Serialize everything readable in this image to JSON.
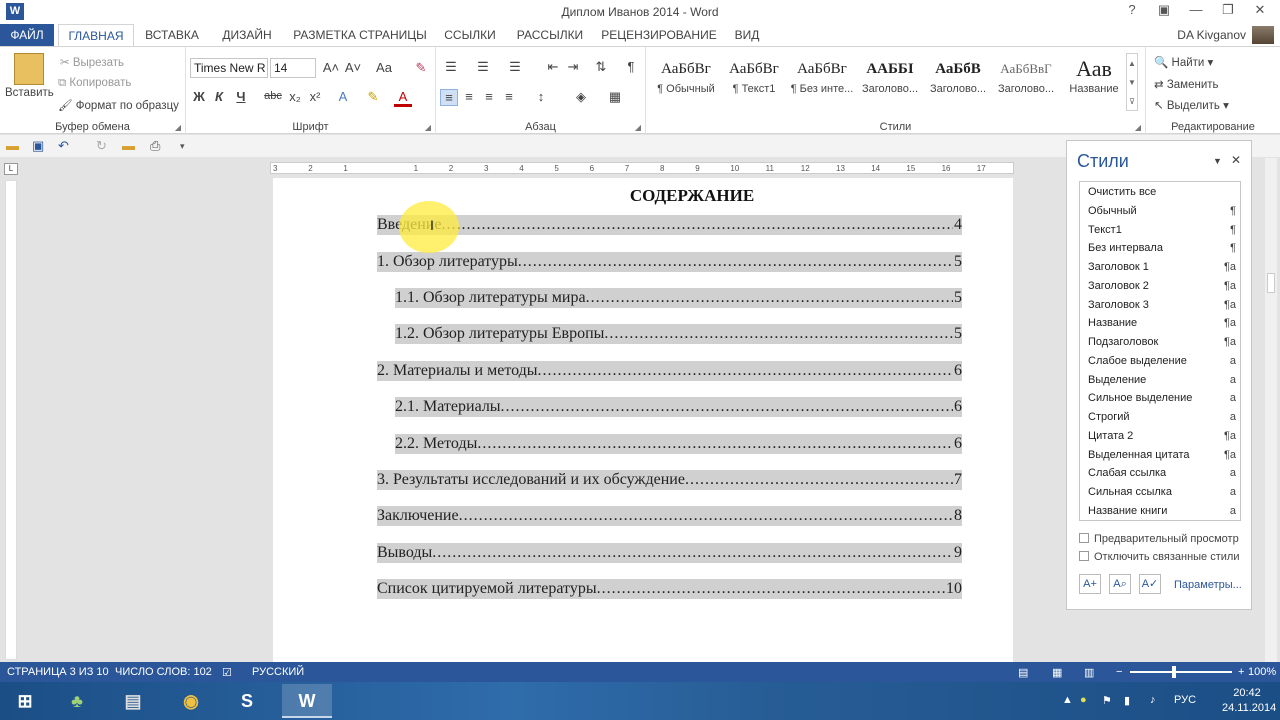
{
  "window": {
    "title": "Диплом Иванов 2014 - Word",
    "app_icon": "W",
    "controls": [
      "?",
      "▣",
      "—",
      "❐",
      "✕"
    ]
  },
  "tabs": [
    "ФАЙЛ",
    "ГЛАВНАЯ",
    "ВСТАВКА",
    "ДИЗАЙН",
    "РАЗМЕТКА СТРАНИЦЫ",
    "ССЫЛКИ",
    "РАССЫЛКИ",
    "РЕЦЕНЗИРОВАНИЕ",
    "ВИД"
  ],
  "user": "DA Kivganov",
  "ribbon": {
    "clipboard": {
      "paste": "Вставить",
      "cut": "Вырезать",
      "copy": "Копировать",
      "format_painter": "Формат по образцу",
      "label": "Буфер обмена"
    },
    "font": {
      "name": "Times New R",
      "size": "14",
      "bold": "Ж",
      "italic": "К",
      "underline": "Ч",
      "strike": "abc",
      "sub": "x₂",
      "sup": "x²",
      "grow": "A˄",
      "shrink": "A˅",
      "case": "Aa",
      "label": "Шрифт"
    },
    "paragraph": {
      "label": "Абзац",
      "pilcrow": "¶"
    },
    "styles": {
      "label": "Стили",
      "tiles": [
        {
          "preview": "АаБбВг",
          "name": "¶ Обычный"
        },
        {
          "preview": "АаБбВг",
          "name": "¶ Текст1"
        },
        {
          "preview": "АаБбВг",
          "name": "¶ Без инте..."
        },
        {
          "preview": "ААББІ",
          "name": "Заголово..."
        },
        {
          "preview": "АаБбВ",
          "name": "Заголово..."
        },
        {
          "preview": "АаБбВвГ",
          "name": "Заголово..."
        },
        {
          "preview": "Аав",
          "name": "Название"
        }
      ]
    },
    "editing": {
      "find": "Найти",
      "replace": "Заменить",
      "select": "Выделить",
      "label": "Редактирование"
    }
  },
  "toc": {
    "heading": "СОДЕРЖАНИЕ",
    "rows": [
      {
        "text": "Введение",
        "page": "4"
      },
      {
        "text": "1. Обзор литературы",
        "page": "5"
      },
      {
        "text": "1.1. Обзор литературы мира",
        "page": "5"
      },
      {
        "text": "1.2. Обзор литературы Европы",
        "page": "5"
      },
      {
        "text": "2. Материалы и методы",
        "page": "6"
      },
      {
        "text": "2.1. Материалы",
        "page": "6"
      },
      {
        "text": "2.2. Методы",
        "page": "6"
      },
      {
        "text": "3. Результаты исследований и их обсуждение",
        "page": "7"
      },
      {
        "text": "Заключение",
        "page": "8"
      },
      {
        "text": "Выводы",
        "page": "9"
      },
      {
        "text": "Список цитируемой литературы",
        "page": "10"
      }
    ]
  },
  "ruler_marks": [
    "3",
    "2",
    "1",
    "1",
    "2",
    "3",
    "4",
    "5",
    "6",
    "7",
    "8",
    "9",
    "10",
    "11",
    "12",
    "13",
    "14",
    "15",
    "16",
    "17"
  ],
  "styles_pane": {
    "title": "Стили",
    "items": [
      {
        "name": "Очистить все",
        "mark": ""
      },
      {
        "name": "Обычный",
        "mark": "¶"
      },
      {
        "name": "Текст1",
        "mark": "¶"
      },
      {
        "name": "Без интервала",
        "mark": "¶"
      },
      {
        "name": "Заголовок 1",
        "mark": "¶a"
      },
      {
        "name": "Заголовок 2",
        "mark": "¶a"
      },
      {
        "name": "Заголовок 3",
        "mark": "¶a"
      },
      {
        "name": "Название",
        "mark": "¶a"
      },
      {
        "name": "Подзаголовок",
        "mark": "¶a"
      },
      {
        "name": "Слабое выделение",
        "mark": "a"
      },
      {
        "name": "Выделение",
        "mark": "a"
      },
      {
        "name": "Сильное выделение",
        "mark": "a"
      },
      {
        "name": "Строгий",
        "mark": "a"
      },
      {
        "name": "Цитата 2",
        "mark": "¶a"
      },
      {
        "name": "Выделенная цитата",
        "mark": "¶a"
      },
      {
        "name": "Слабая ссылка",
        "mark": "a"
      },
      {
        "name": "Сильная ссылка",
        "mark": "a"
      },
      {
        "name": "Название книги",
        "mark": "a"
      }
    ],
    "preview_label": "Предварительный просмотр",
    "linked_label": "Отключить связанные стили",
    "options_link": "Параметры..."
  },
  "status": {
    "page": "СТРАНИЦА 3 ИЗ 10",
    "words": "ЧИСЛО СЛОВ: 102",
    "language": "РУССКИЙ",
    "zoom": "100%",
    "zoom_minus": "−",
    "zoom_plus": "+"
  },
  "taskbar": {
    "lang": "РУС",
    "time": "20:42",
    "date": "24.11.2014",
    "skype": "S",
    "word": "W"
  },
  "colors": {
    "accent": "#2b579a",
    "toc_field": "#d0d0d0",
    "highlight": "#ffeb3c"
  }
}
